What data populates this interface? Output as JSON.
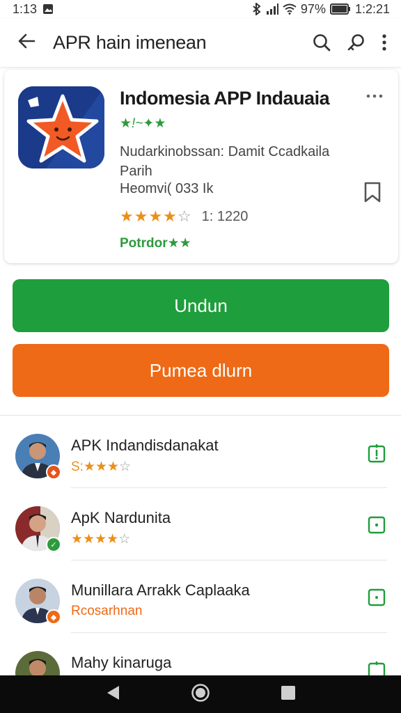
{
  "status_bar": {
    "time_left": "1:13",
    "battery": "97%",
    "time_right": "1:2:21"
  },
  "app_bar": {
    "title": "APR hain imenean"
  },
  "card": {
    "title": "Indomesia APP Indauaia",
    "tagline": "★!~✦★",
    "developer": "Nudarkinobssan: Damit Ccadkaila Parih",
    "size": "Heomvi( 033 Ik",
    "rating_value": "1: 1220",
    "rating_stars": 3.5,
    "badge": "Potrdor★★"
  },
  "buttons": {
    "primary": "Undun",
    "secondary": "Pumea dlurn"
  },
  "list": [
    {
      "title": "APK Indandisdanakat",
      "subtitle": "S:★★★",
      "subtitle_color": "#e9901c",
      "badge_color": "#e5541c",
      "avatar_bg": "#4a7fb5"
    },
    {
      "title": "ApK Nardunita",
      "subtitle": "★★★★",
      "subtitle_color": "#e9901c",
      "badge_color": "#2e9a3d",
      "avatar_bg": "#8a2a2a"
    },
    {
      "title": "Munillara Arrakk Caplaaka",
      "subtitle": "Rcosarhnan",
      "subtitle_color": "#ee6a16",
      "badge_color": "#ee6a16",
      "avatar_bg": "#c7d3e0"
    },
    {
      "title": "Mahy kinaruga",
      "subtitle": "",
      "subtitle_color": "#e9901c",
      "badge_color": "#2e9a3d",
      "avatar_bg": "#5b6b3a"
    }
  ],
  "colors": {
    "green": "#1e9e3c",
    "orange": "#ee6a16",
    "star": "#e9901c"
  }
}
